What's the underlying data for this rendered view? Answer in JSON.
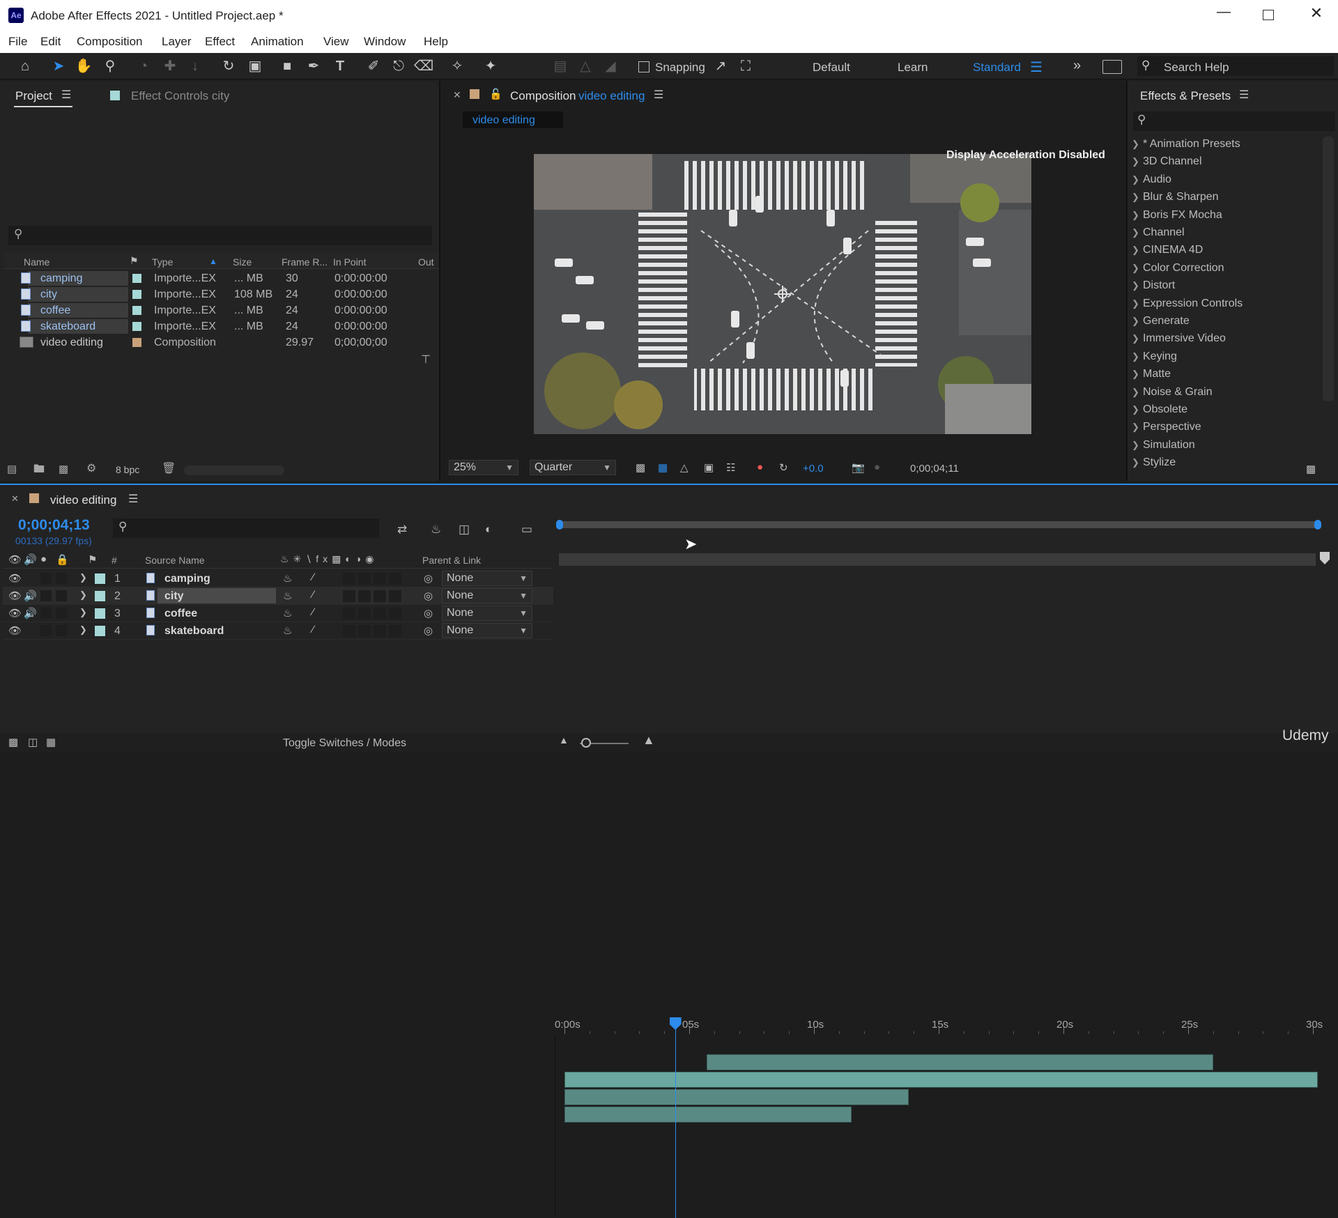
{
  "window": {
    "title": "Adobe After Effects 2021 - Untitled Project.aep *",
    "app_icon": "Ae"
  },
  "menu": [
    "File",
    "Edit",
    "Composition",
    "Layer",
    "Effect",
    "Animation",
    "View",
    "Window",
    "Help"
  ],
  "toolbar": {
    "snapping_label": "Snapping",
    "workspaces": [
      "Default",
      "Learn",
      "Standard"
    ],
    "active_workspace": "Standard",
    "search_placeholder": "Search Help"
  },
  "project_panel": {
    "tab_project": "Project",
    "tab_effect_controls": "Effect Controls city",
    "columns": [
      "Name",
      "Type",
      "Size",
      "Frame R...",
      "In Point",
      "Out"
    ],
    "items": [
      {
        "name": "camping",
        "type": "Importe...EX",
        "size": "... MB",
        "frame_rate": "30",
        "in_point": "0:00:00:00",
        "kind": "footage"
      },
      {
        "name": "city",
        "type": "Importe...EX",
        "size": "108 MB",
        "frame_rate": "24",
        "in_point": "0:00:00:00",
        "kind": "footage"
      },
      {
        "name": "coffee",
        "type": "Importe...EX",
        "size": "... MB",
        "frame_rate": "24",
        "in_point": "0:00:00:00",
        "kind": "footage"
      },
      {
        "name": "skateboard",
        "type": "Importe...EX",
        "size": "... MB",
        "frame_rate": "24",
        "in_point": "0:00:00:00",
        "kind": "footage"
      },
      {
        "name": "video editing",
        "type": "Composition",
        "size": "",
        "frame_rate": "29.97",
        "in_point": "0;00;00;00",
        "kind": "composition"
      }
    ],
    "bpc": "8 bpc"
  },
  "composition_panel": {
    "label": "Composition",
    "comp_name": "video editing",
    "tab": "video editing",
    "notice": "Display Acceleration Disabled",
    "zoom": "25%",
    "resolution": "Quarter",
    "exposure": "+0.0",
    "timecode": "0;00;04;11"
  },
  "effects_panel": {
    "title": "Effects & Presets",
    "categories": [
      "* Animation Presets",
      "3D Channel",
      "Audio",
      "Blur & Sharpen",
      "Boris FX Mocha",
      "Channel",
      "CINEMA 4D",
      "Color Correction",
      "Distort",
      "Expression Controls",
      "Generate",
      "Immersive Video",
      "Keying",
      "Matte",
      "Noise & Grain",
      "Obsolete",
      "Perspective",
      "Simulation",
      "Stylize"
    ]
  },
  "timeline": {
    "comp_tab": "video editing",
    "current_time": "0;00;04;13",
    "frame_info": "00133 (29.97 fps)",
    "col_source_name": "Source Name",
    "col_parent": "Parent & Link",
    "ruler_ticks": [
      "0:00s",
      "05s",
      "10s",
      "15s",
      "20s",
      "25s",
      "30s"
    ],
    "duration_s": 30,
    "playhead_s": 4.43,
    "layers": [
      {
        "num": "1",
        "name": "camping",
        "parent": "None",
        "start_s": 5.7,
        "end_s": 26.0,
        "audio": false,
        "selected": false
      },
      {
        "num": "2",
        "name": "city",
        "parent": "None",
        "start_s": 0,
        "end_s": 30.2,
        "audio": true,
        "selected": true
      },
      {
        "num": "3",
        "name": "coffee",
        "parent": "None",
        "start_s": 0,
        "end_s": 13.8,
        "audio": true,
        "selected": false
      },
      {
        "num": "4",
        "name": "skateboard",
        "parent": "None",
        "start_s": 0,
        "end_s": 11.5,
        "audio": false,
        "selected": false
      }
    ],
    "toggle_label": "Toggle Switches / Modes"
  },
  "watermark": "Udemy",
  "colors": {
    "accent": "#2d8ceb",
    "layer_bar": "#5a8a84",
    "label_aqua": "#a6d8d8",
    "label_tan": "#c9a27a"
  }
}
